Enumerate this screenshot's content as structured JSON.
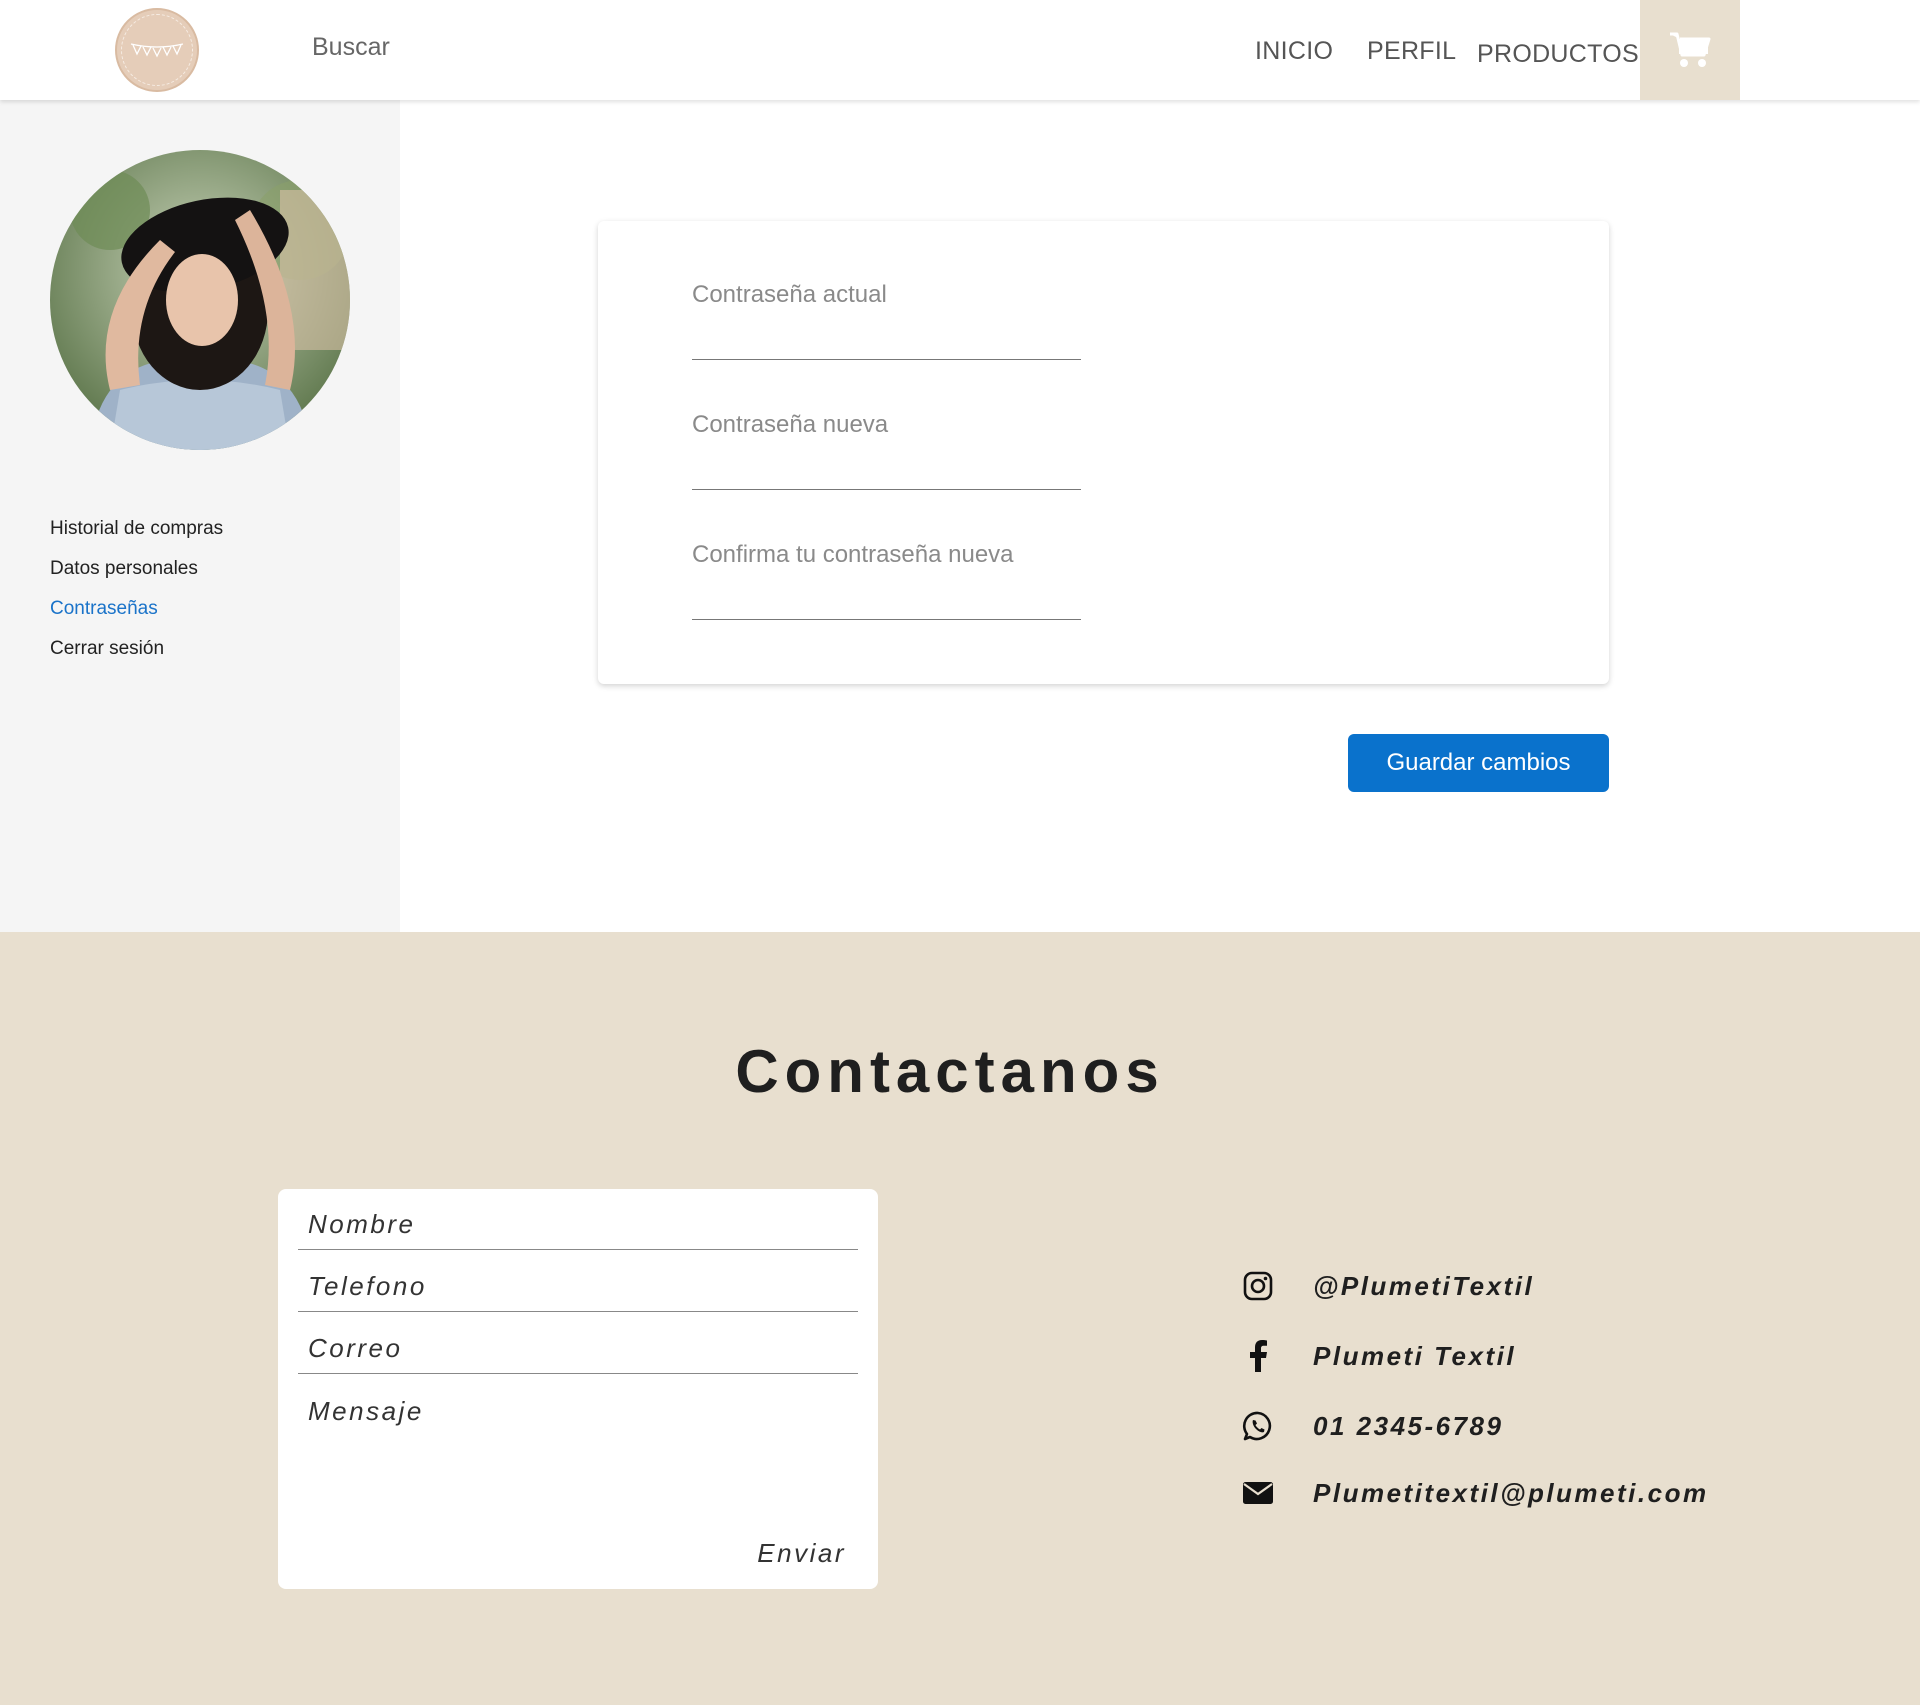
{
  "header": {
    "search": "Buscar",
    "nav": [
      "INICIO",
      "PERFIL",
      "PRODUCTOS"
    ],
    "cart_icon": "cart-icon",
    "logo_icon": "bunting-logo"
  },
  "sidebar": {
    "avatar_alt": "profile-photo",
    "items": [
      {
        "label": "Historial de compras"
      },
      {
        "label": "Datos personales"
      },
      {
        "label": "Contraseñas"
      },
      {
        "label": "Cerrar sesión"
      }
    ],
    "active_color": "#1a73c9"
  },
  "password_form": {
    "fields": [
      {
        "label": "Contraseña actual"
      },
      {
        "label": "Contraseña nueva"
      },
      {
        "label": "Confirma tu contraseña nueva"
      }
    ],
    "save_label": "Guardar cambios",
    "save_color": "#0a72cc"
  },
  "footer": {
    "title": "Contactanos",
    "background": "#e8dfcf",
    "form": {
      "name": "Nombre",
      "phone": "Telefono",
      "email": "Correo",
      "message": "Mensaje",
      "send": "Enviar"
    },
    "contacts": [
      {
        "icon": "instagram-icon",
        "text": "@PlumetiTextil"
      },
      {
        "icon": "facebook-icon",
        "text": "Plumeti Textil"
      },
      {
        "icon": "whatsapp-icon",
        "text": "01 2345-6789"
      },
      {
        "icon": "mail-icon",
        "text": "Plumetitextil@plumeti.com"
      }
    ]
  }
}
